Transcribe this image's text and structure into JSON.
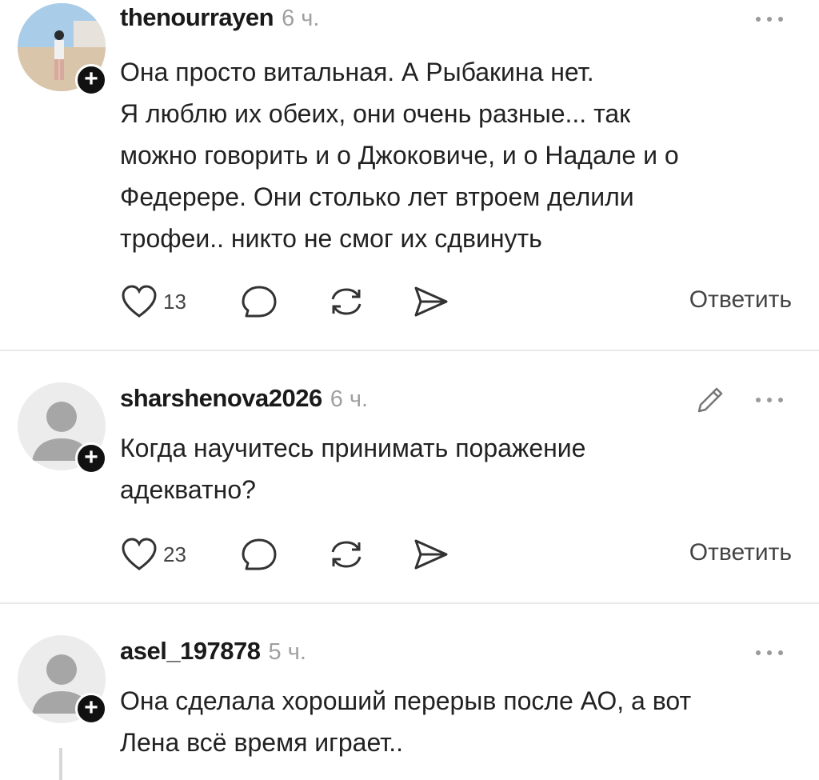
{
  "comments": [
    {
      "username": "thenourrayen",
      "time": "6 ч.",
      "text": "Она просто витальная. А Рыбакина нет.\nЯ люблю их обеих, они очень разные... так\nможно говорить и о Джоковиче, и о Надале и о\nФедерере. Они столько лет втроем делили\nтрофеи.. никто не смог их сдвинуть",
      "likes": "13",
      "reply_label": "Ответить"
    },
    {
      "username": "sharshenova2026",
      "time": "6 ч.",
      "text": "Когда научитесь принимать поражение\nадекватно?",
      "likes": "23",
      "reply_label": "Ответить"
    },
    {
      "username": "asel_197878",
      "time": "5 ч.",
      "text": "Она сделала хороший перерыв после АО, а вот\nЛена всё время играет.."
    }
  ],
  "icons": {
    "plus": "+",
    "like": "heart-icon",
    "comment": "comment-icon",
    "repost": "repost-icon",
    "share": "share-icon",
    "more": "more-icon",
    "edit": "pencil-icon"
  },
  "colors": {
    "text": "#222222",
    "muted": "#a0a0a0",
    "divider": "#e9e9e9"
  }
}
